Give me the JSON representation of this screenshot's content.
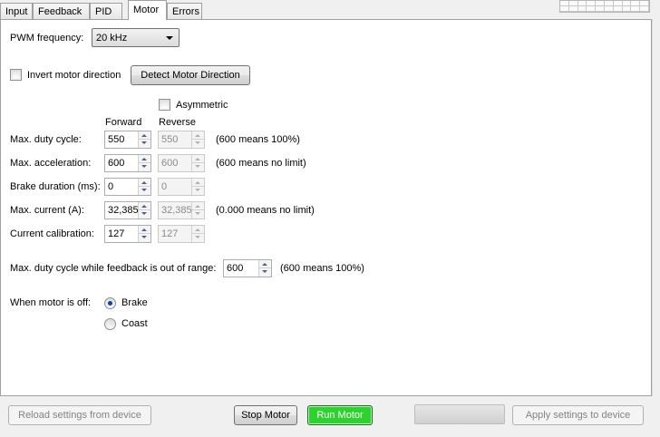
{
  "tabs": [
    {
      "label": "Input"
    },
    {
      "label": "Feedback"
    },
    {
      "label": "PID"
    },
    {
      "label": "Motor",
      "active": true
    },
    {
      "label": "Errors"
    }
  ],
  "pwm": {
    "label": "PWM frequency:",
    "value": "20 kHz"
  },
  "invert": {
    "label": "Invert motor direction",
    "checked": false
  },
  "detect_button": "Detect Motor Direction",
  "asymmetric": {
    "label": "Asymmetric",
    "checked": false
  },
  "columns": {
    "forward": "Forward",
    "reverse": "Reverse"
  },
  "rows": [
    {
      "label": "Max. duty cycle:",
      "forward": "550",
      "reverse": "550",
      "note": "(600 means 100%)"
    },
    {
      "label": "Max. acceleration:",
      "forward": "600",
      "reverse": "600",
      "note": "(600 means no limit)"
    },
    {
      "label": "Brake duration (ms):",
      "forward": "0",
      "reverse": "0",
      "note": ""
    },
    {
      "label": "Max. current (A):",
      "forward": "32,385",
      "reverse": "32,385",
      "note": "(0.000 means no limit)"
    },
    {
      "label": "Current calibration:",
      "forward": "127",
      "reverse": "127",
      "note": ""
    }
  ],
  "out_of_range": {
    "label": "Max. duty cycle while feedback is out of range:",
    "value": "600",
    "note": "(600 means 100%)"
  },
  "motor_off": {
    "label": "When motor is off:",
    "options": [
      {
        "label": "Brake",
        "checked": true
      },
      {
        "label": "Coast",
        "checked": false
      }
    ]
  },
  "bottom": {
    "reload": "Reload settings from device",
    "stop": "Stop Motor",
    "run": "Run Motor",
    "apply": "Apply settings to device"
  },
  "colors": {
    "run_button": "#2ed22e"
  }
}
